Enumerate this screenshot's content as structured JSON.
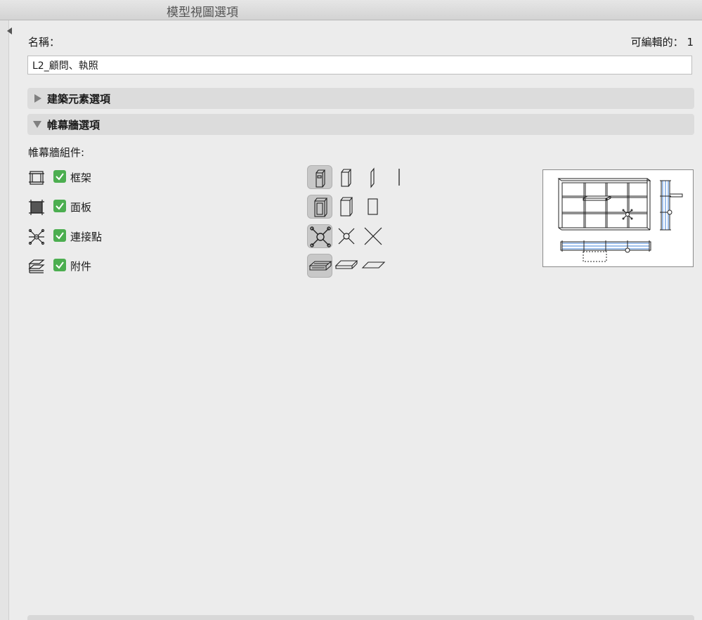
{
  "window": {
    "title": "模型視圖選項"
  },
  "name_field": {
    "label": "名稱：",
    "value": "L2_顧問、執照"
  },
  "editable": {
    "label": "可編輯的：",
    "count": "1"
  },
  "sections": [
    {
      "label": "建築元素選項",
      "expanded": false
    },
    {
      "label": "帷幕牆選項",
      "expanded": true
    }
  ],
  "components_label": "帷幕牆組件:",
  "components": [
    {
      "label": "框架",
      "checked": true,
      "icon": "frame-icon",
      "options": [
        "full-frame-icon",
        "simplified-frame-icon",
        "thin-frame-icon",
        "line-frame-icon"
      ],
      "selected": 0
    },
    {
      "label": "面板",
      "checked": true,
      "icon": "panel-icon",
      "options": [
        "full-panel-icon",
        "simplified-panel-icon",
        "outline-panel-icon"
      ],
      "selected": 0
    },
    {
      "label": "連接點",
      "checked": true,
      "icon": "junction-icon",
      "options": [
        "full-junction-icon",
        "simplified-junction-icon",
        "cross-junction-icon"
      ],
      "selected": 0
    },
    {
      "label": "附件",
      "checked": true,
      "icon": "accessory-icon",
      "options": [
        "full-accessory-icon",
        "simplified-accessory-icon",
        "outline-accessory-icon"
      ],
      "selected": 0
    }
  ],
  "colors": {
    "check_green": "#4cae50",
    "preview_blue": "#3d7fd6"
  }
}
